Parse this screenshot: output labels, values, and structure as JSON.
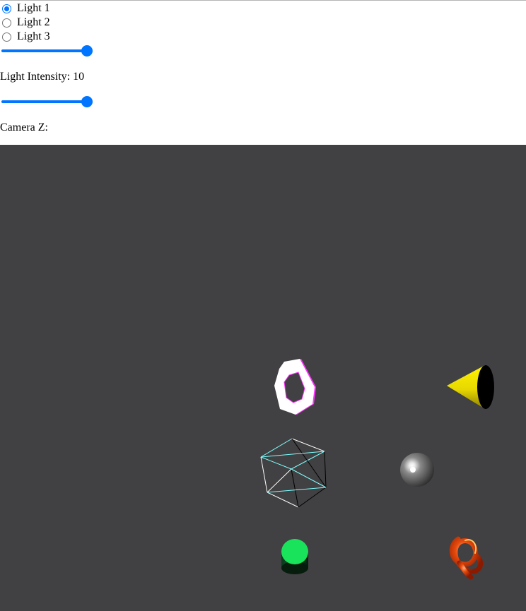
{
  "lights": [
    {
      "label": "Light 1",
      "checked": true
    },
    {
      "label": "Light 2",
      "checked": false
    },
    {
      "label": "Light 3",
      "checked": false
    }
  ],
  "intensity": {
    "label": "Light Intensity: 10",
    "value": 10,
    "fill_fraction": 1.0
  },
  "camera": {
    "label": "Camera Z:",
    "fill_fraction": 1.0
  },
  "scene": {
    "background": "#414042",
    "objects": [
      {
        "name": "hexagonal-ring",
        "color": "#ffffff",
        "edge_color": "#ff33ff"
      },
      {
        "name": "cone",
        "color": "#f2e600"
      },
      {
        "name": "wireframe-cube",
        "color": "#ffffff",
        "edge_color": "#7fffff"
      },
      {
        "name": "sphere",
        "color": "#8a8a8a"
      },
      {
        "name": "cylinder",
        "color": "#19e35a"
      },
      {
        "name": "torus-knot",
        "color": "#e04a10"
      }
    ]
  },
  "accent_color": "#0075ff"
}
